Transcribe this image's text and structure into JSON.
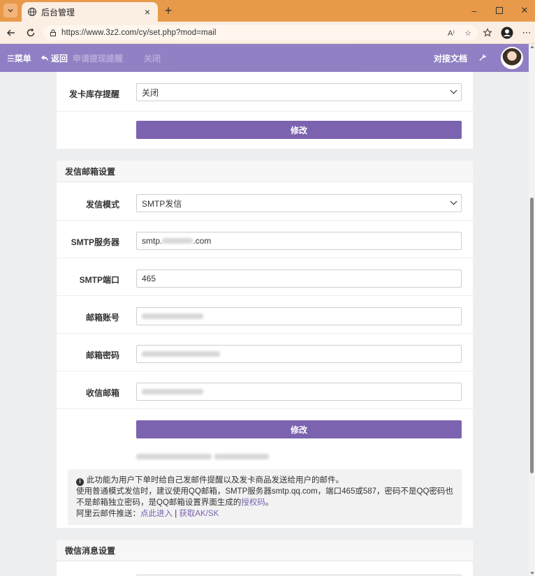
{
  "browser": {
    "tab_title": "后台管理",
    "url": "https://www.3z2.com/cy/set.php?mod=mail",
    "read_aloud": "A⁾"
  },
  "nav": {
    "menu_label": "☰菜单",
    "back_label": "返回",
    "ghost_label": "申请提现提醒",
    "ghost_value": "关闭",
    "docs_label": "对接文档"
  },
  "card1": {
    "stock_label": "发卡库存提醒",
    "stock_value": "关闭",
    "submit": "修改"
  },
  "mail": {
    "header": "发信邮箱设置",
    "mode_label": "发信模式",
    "mode_value": "SMTP发信",
    "smtp_label": "SMTP服务器",
    "smtp_prefix": "smtp.",
    "smtp_suffix": ".com",
    "port_label": "SMTP端口",
    "port_value": "465",
    "account_label": "邮箱账号",
    "password_label": "邮箱密码",
    "recipient_label": "收信邮箱",
    "submit": "修改",
    "tip_line1": "此功能为用户下单时给自己发邮件提醒以及发卡商品发送给用户的邮件。",
    "tip_line2": "使用普通模式发信时，建议使用QQ邮箱，SMTP服务器smtp.qq.com，端口465或587，密码不是QQ密码也",
    "tip_line3": "不是邮箱独立密码，是QQ邮箱设置界面生成的",
    "tip_link_auth": "授权码",
    "tip_line3_end": "。",
    "tip_line4": "阿里云邮件推送：",
    "tip_link_enter": "点此进入",
    "tip_sep": " | ",
    "tip_link_ak": "获取AK/SK"
  },
  "wechat": {
    "header": "微信消息设置"
  },
  "colors": {
    "accent": "#7b63b0",
    "navbar": "#8e7cc3",
    "tabbar": "#e89a4a"
  }
}
